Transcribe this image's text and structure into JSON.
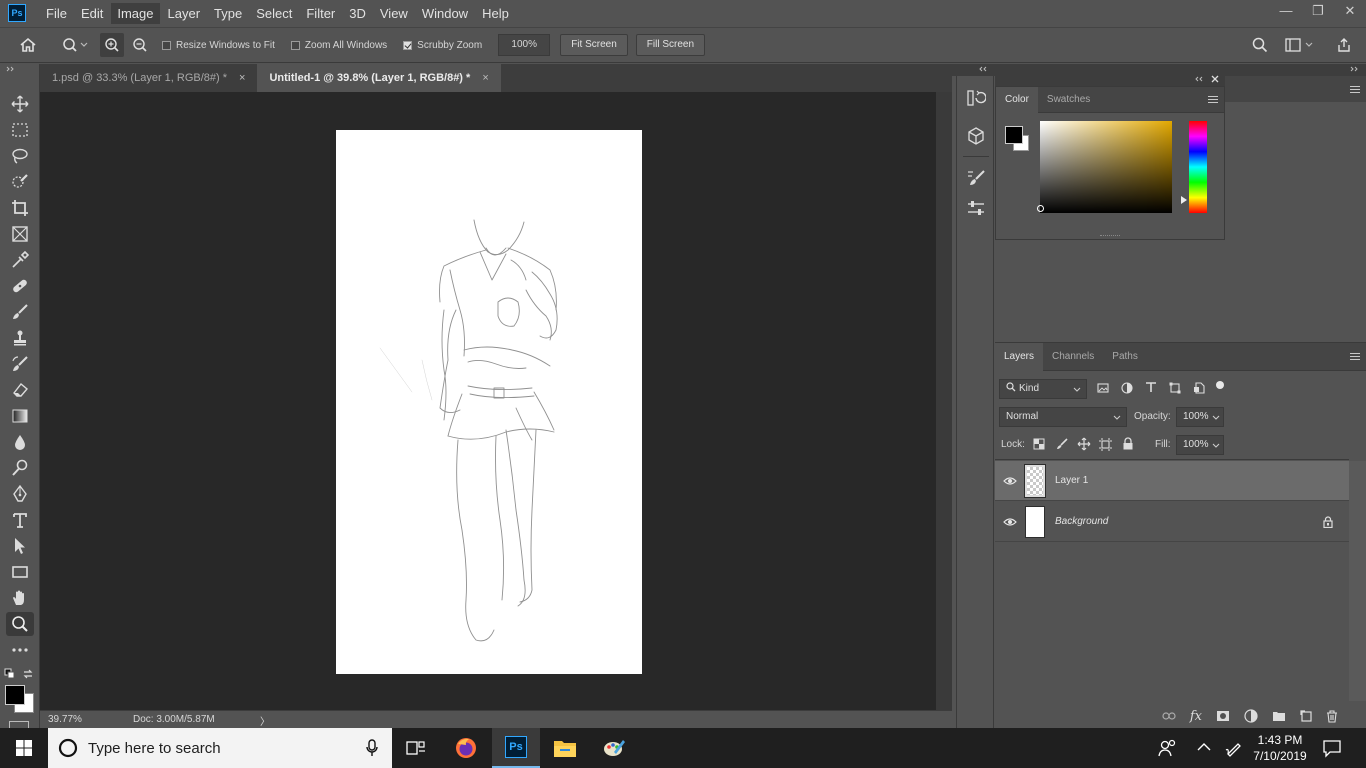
{
  "app": {
    "logo": "Ps",
    "menu": [
      "File",
      "Edit",
      "Image",
      "Layer",
      "Type",
      "Select",
      "Filter",
      "3D",
      "View",
      "Window",
      "Help"
    ],
    "active_menu": "Image"
  },
  "window_controls": {
    "minimize": "—",
    "restore": "❐",
    "close": "✕"
  },
  "options": {
    "resize_windows": {
      "label": "Resize Windows to Fit",
      "checked": false
    },
    "zoom_all": {
      "label": "Zoom All Windows",
      "checked": false
    },
    "scrubby_zoom": {
      "label": "Scrubby Zoom",
      "checked": true
    },
    "zoom_value": "100%",
    "fit_screen": "Fit Screen",
    "fill_screen": "Fill Screen"
  },
  "tabs": [
    {
      "label": "1.psd @ 33.3% (Layer 1, RGB/8#) *",
      "close": "×"
    },
    {
      "label": "Untitled-1 @ 39.8% (Layer 1, RGB/8#) *",
      "close": "×"
    }
  ],
  "status": {
    "zoom": "39.77%",
    "doc": "Doc: 3.00M/5.87M",
    "arrow": "〉"
  },
  "color_panel": {
    "tabs": [
      "Color",
      "Swatches"
    ],
    "foreground": "#000000",
    "background": "#ffffff",
    "hue_color": "#e2a800"
  },
  "layers_panel": {
    "tabs": [
      "Layers",
      "Channels",
      "Paths"
    ],
    "filter_kind": "Kind",
    "blend_mode": "Normal",
    "opacity_label": "Opacity:",
    "opacity": "100%",
    "lock_label": "Lock:",
    "fill_label": "Fill:",
    "fill": "100%",
    "layers": [
      {
        "name": "Layer 1",
        "selected": true,
        "visible": true
      },
      {
        "name": "Background",
        "selected": false,
        "visible": true,
        "locked": true
      }
    ]
  },
  "taskbar": {
    "search_placeholder": "Type here to search",
    "time": "1:43 PM",
    "date": "7/10/2019"
  }
}
